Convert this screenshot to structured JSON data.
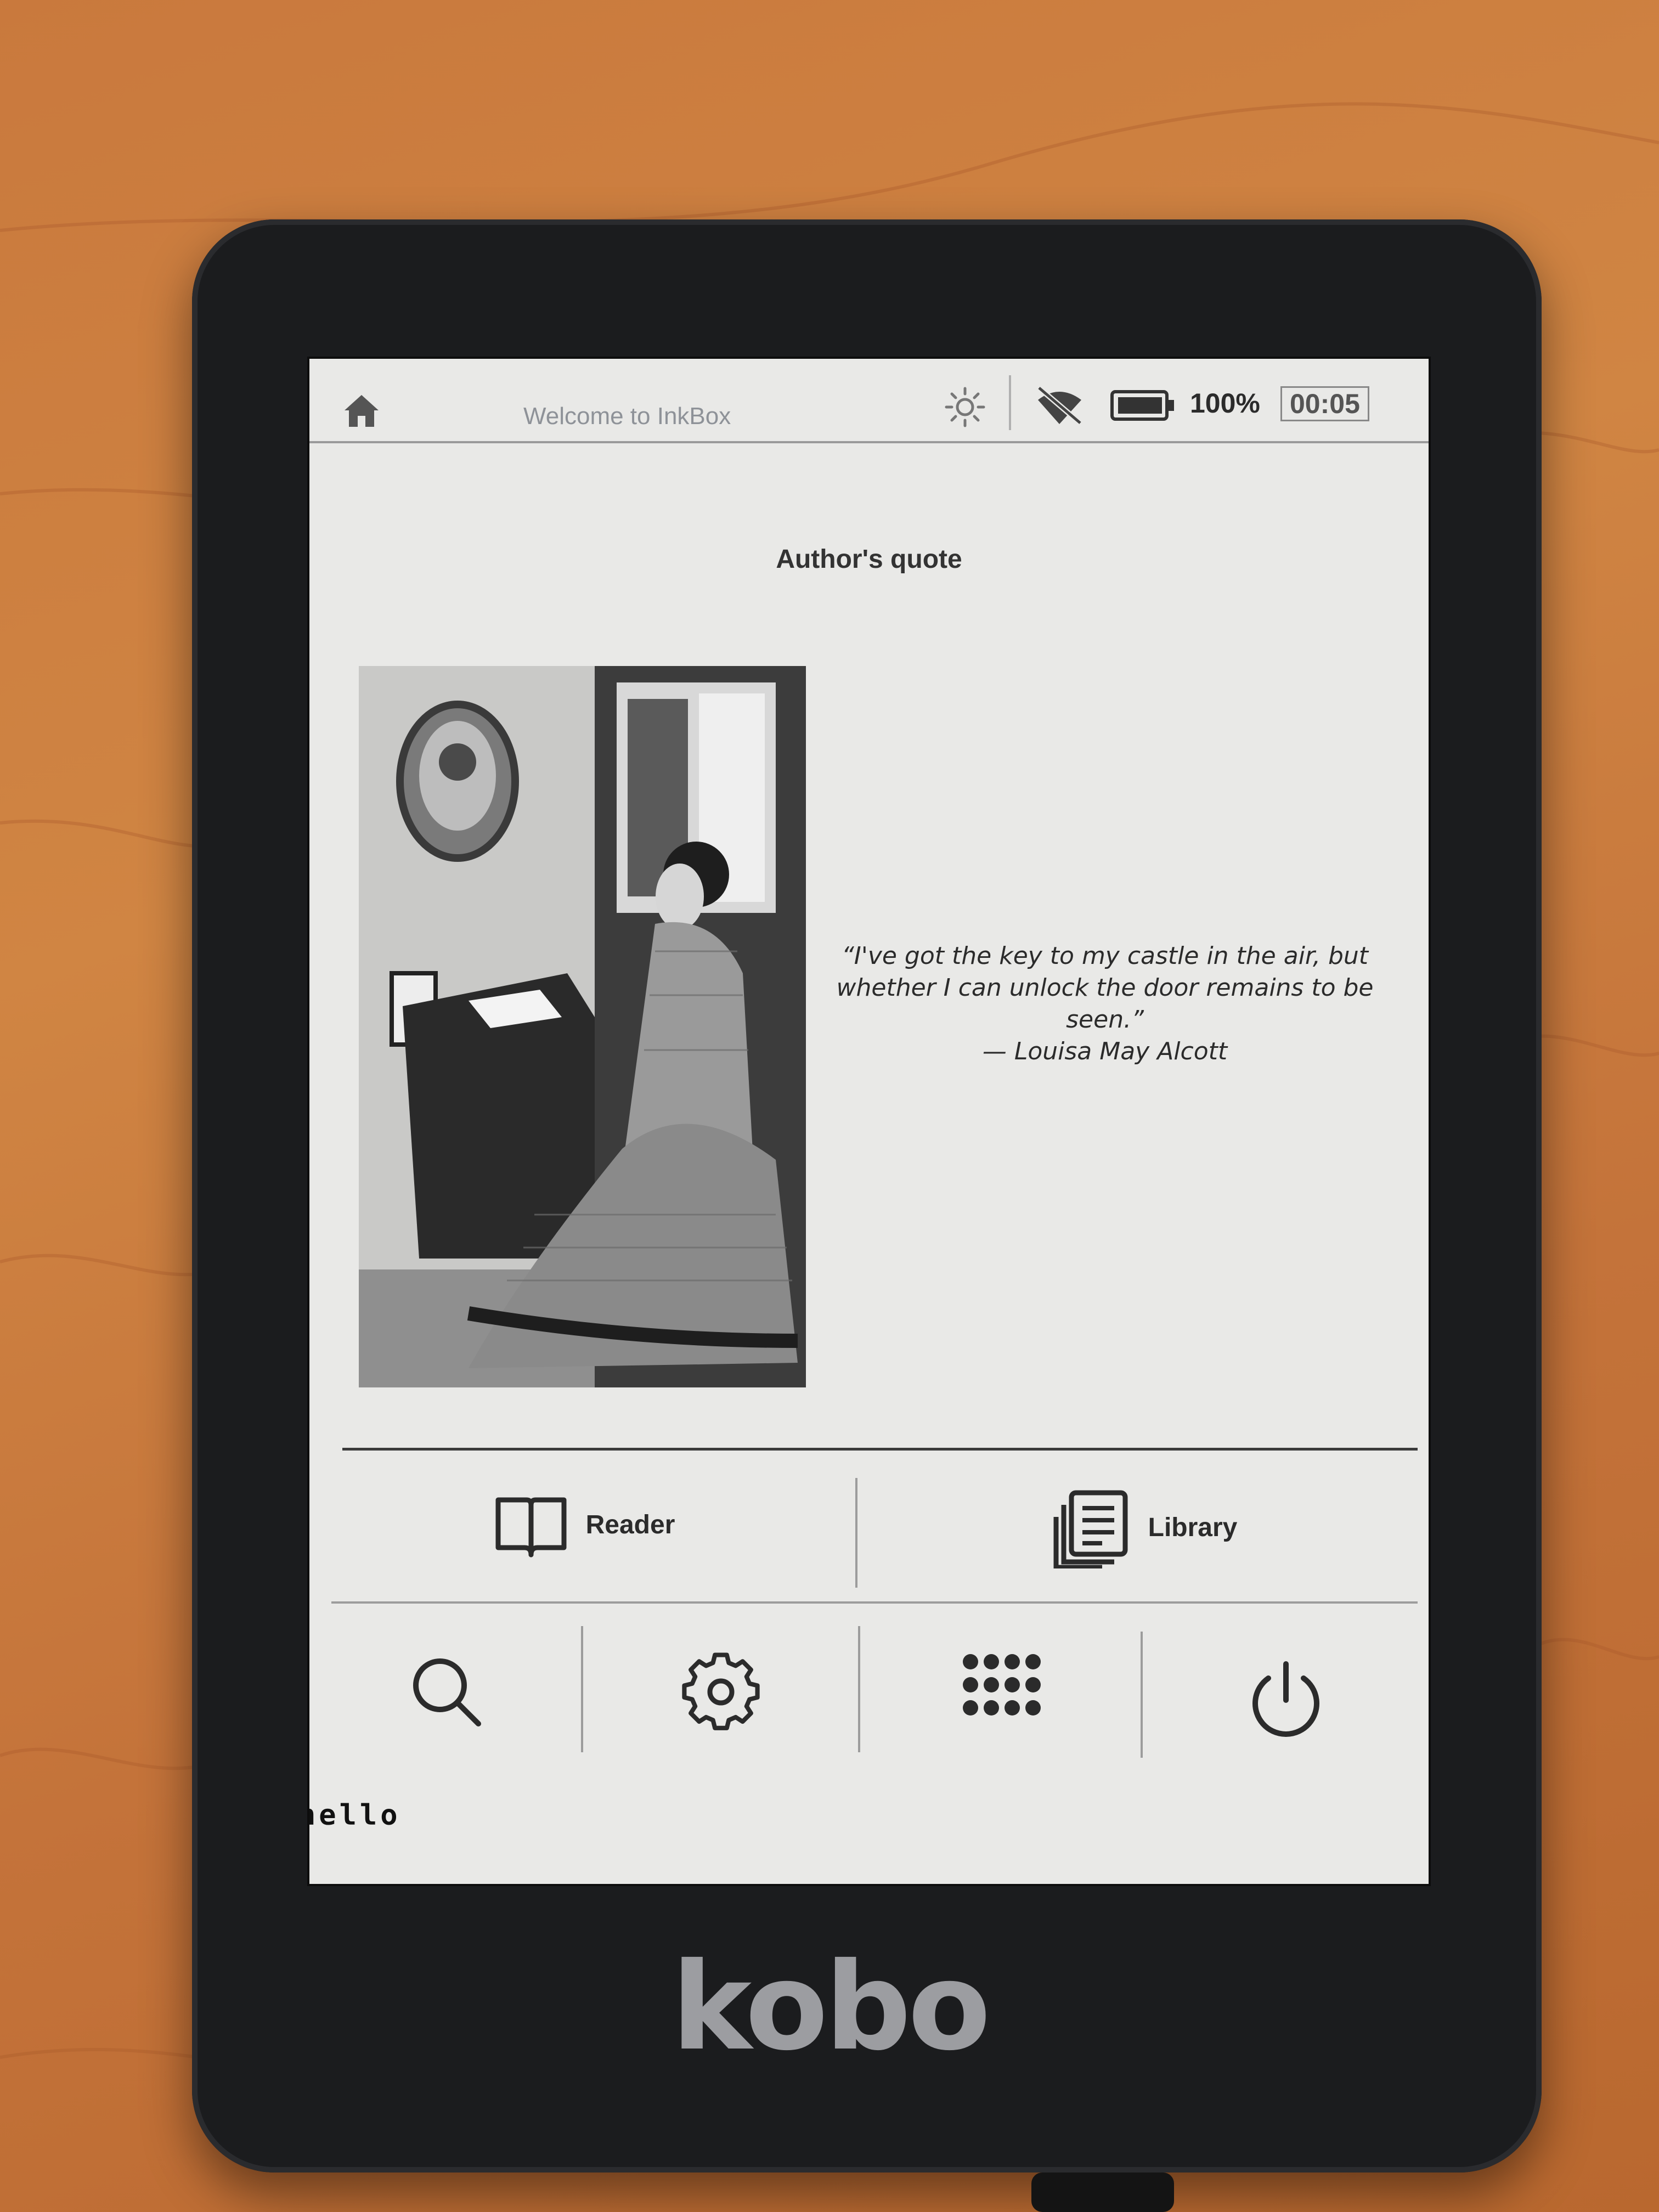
{
  "status_bar": {
    "title": "Welcome to InkBox",
    "battery_level": "100%",
    "clock": "00:05"
  },
  "home": {
    "section_title": "Author's quote",
    "quote_text": "“I've got the key to my castle in the air, but whether I can unlock the door remains to be seen.”",
    "quote_author": "— Louisa May Alcott",
    "image_icon": "author-portrait-photo"
  },
  "main_buttons": [
    {
      "label": "Reader",
      "icon": "book-icon"
    },
    {
      "label": "Library",
      "icon": "library-icon"
    }
  ],
  "bottom_toolbar": [
    {
      "icon": "search-icon"
    },
    {
      "icon": "gear-icon"
    },
    {
      "icon": "apps-grid-icon"
    },
    {
      "icon": "power-icon"
    }
  ],
  "debug_text": "hello",
  "device": {
    "brand_logo": "kobo"
  }
}
